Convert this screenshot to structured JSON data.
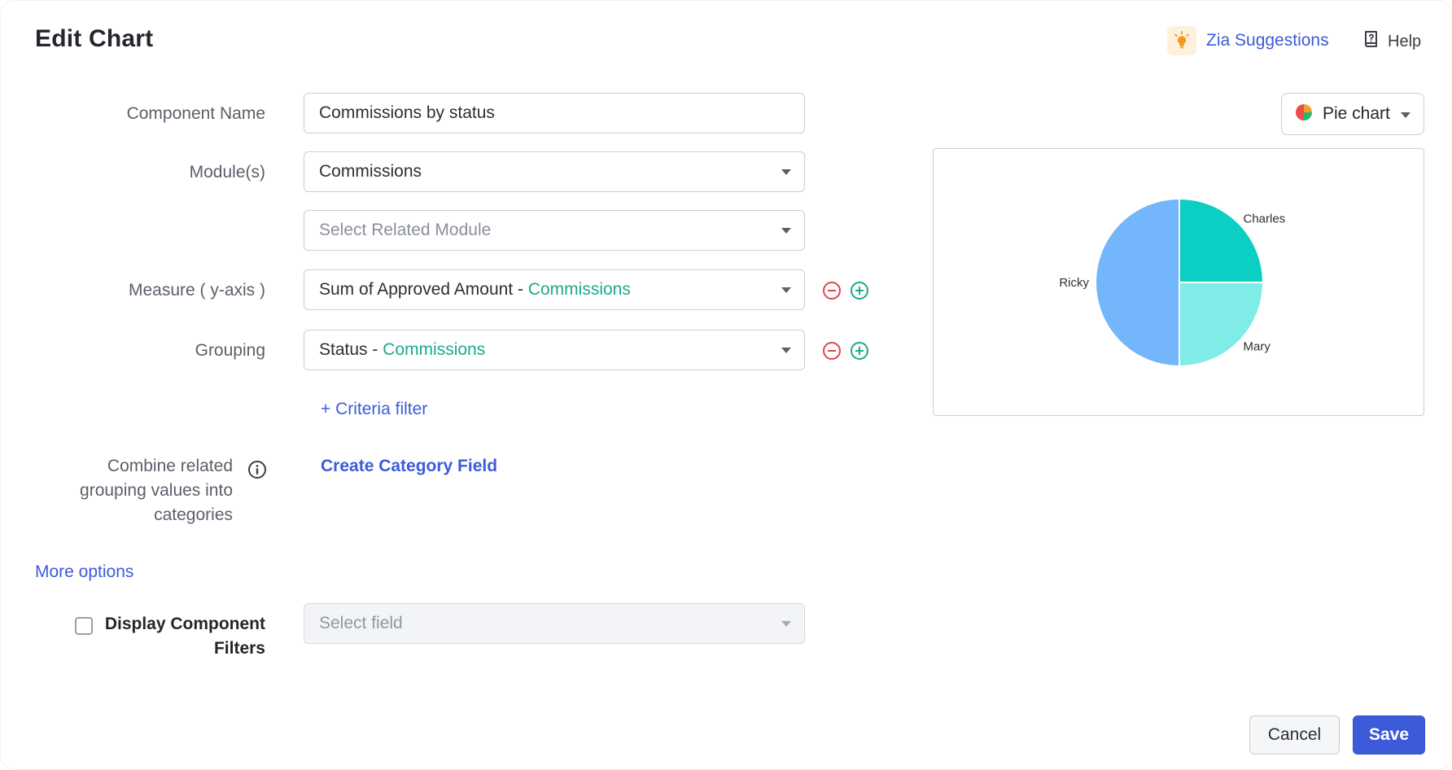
{
  "header": {
    "title": "Edit Chart",
    "zia_label": "Zia Suggestions",
    "help_label": "Help"
  },
  "form": {
    "component_name": {
      "label": "Component Name",
      "value": "Commissions by status"
    },
    "modules": {
      "label": "Module(s)",
      "value": "Commissions"
    },
    "related_module": {
      "placeholder": "Select Related Module"
    },
    "measure": {
      "label": "Measure ( y-axis )",
      "value": "Sum of Approved Amount",
      "separator": " - ",
      "module": "Commissions"
    },
    "grouping": {
      "label": "Grouping",
      "value": "Status",
      "separator": " - ",
      "module": "Commissions"
    },
    "criteria_filter_link": "+ Criteria filter",
    "combine": {
      "label_line1": "Combine related",
      "label_line2": "grouping values into",
      "label_line3": "categories",
      "link": "Create Category Field"
    },
    "more_options_link": "More options",
    "display_filters": {
      "label_line1": "Display Component",
      "label_line2": "Filters",
      "checked": false,
      "placeholder": "Select field"
    }
  },
  "chart_type": {
    "selected": "Pie chart",
    "icon": "pie-chart-icon"
  },
  "chart_data": {
    "type": "pie",
    "labels": [
      "Charles",
      "Mary",
      "Ricky"
    ],
    "values": [
      25,
      25,
      50
    ],
    "colors": [
      "#0ccfc4",
      "#7fece7",
      "#74b6fb"
    ]
  },
  "footer": {
    "cancel_label": "Cancel",
    "save_label": "Save"
  },
  "colors": {
    "accent": "#3d5bd9",
    "module_accent": "#1ea88a",
    "remove": "#e2444e",
    "add": "#1ea88a"
  }
}
